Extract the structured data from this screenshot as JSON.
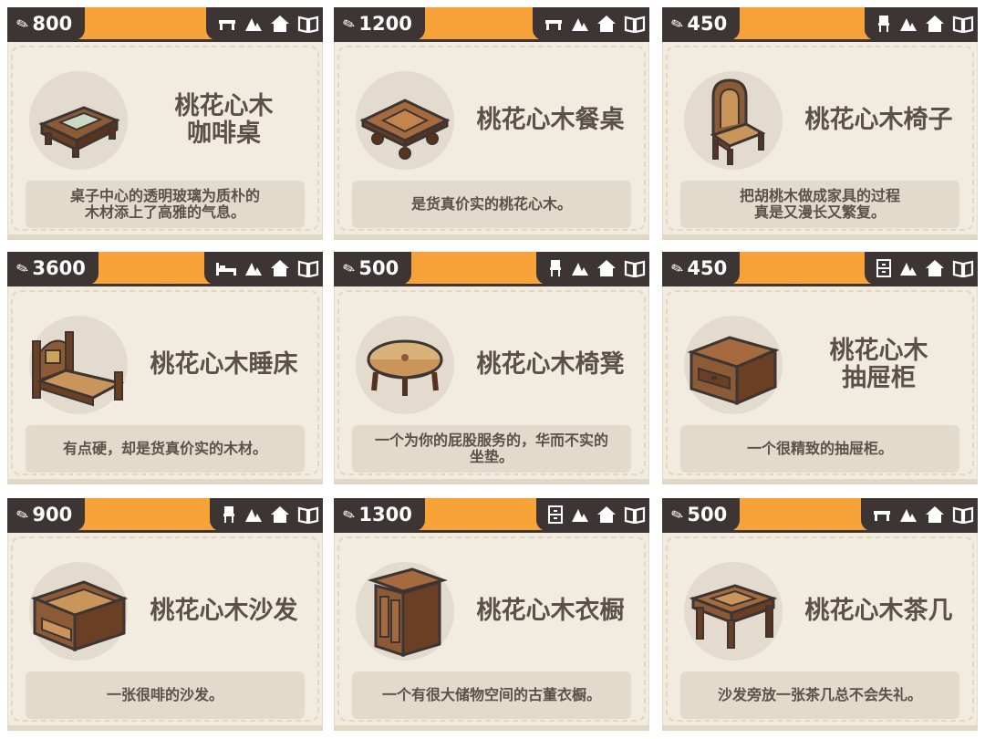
{
  "cards": [
    {
      "price": "800",
      "name": "桃花心木\n咖啡桌",
      "desc": "桌子中心的透明玻璃为质朴的\n木材添上了高雅的气息。",
      "category_icon": "table-icon"
    },
    {
      "price": "1200",
      "name": "桃花心木餐桌",
      "desc": "是货真价实的桃花心木。",
      "category_icon": "table-icon"
    },
    {
      "price": "450",
      "name": "桃花心木椅子",
      "desc": "把胡桃木做成家具的过程\n真是又漫长又繁复。",
      "category_icon": "chair-icon"
    },
    {
      "price": "3600",
      "name": "桃花心木睡床",
      "desc": "有点硬，却是货真价实的木材。",
      "category_icon": "bed-icon"
    },
    {
      "price": "500",
      "name": "桃花心木椅凳",
      "desc": "一个为你的屁股服务的，华而不实的\n坐垫。",
      "category_icon": "chair-icon"
    },
    {
      "price": "450",
      "name": "桃花心木\n抽屉柜",
      "desc": "一个很精致的抽屉柜。",
      "category_icon": "cabinet-icon"
    },
    {
      "price": "900",
      "name": "桃花心木沙发",
      "desc": "一张很啡的沙发。",
      "category_icon": "chair-icon"
    },
    {
      "price": "1300",
      "name": "桃花心木衣橱",
      "desc": "一个有很大储物空间的古董衣橱。",
      "category_icon": "cabinet-icon"
    },
    {
      "price": "500",
      "name": "桃花心木茶几",
      "desc": "沙发旁放一张茶几总不会失礼。",
      "category_icon": "table-icon"
    }
  ],
  "colors": {
    "accent": "#f8a33a",
    "dark": "#3c3533",
    "card_bg": "#f1ecdf",
    "text": "#5b514a"
  }
}
